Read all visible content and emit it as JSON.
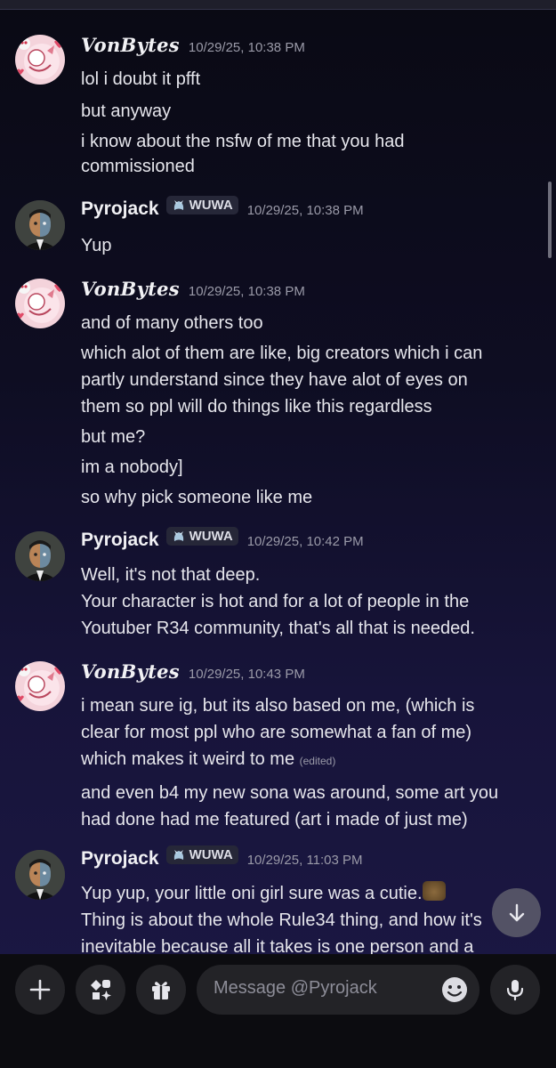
{
  "messages": [
    {
      "author": "VonBytes",
      "timestamp": "10/29/25, 10:38 PM",
      "lines": [
        "lol i doubt it pfft",
        "but anyway",
        "i know about the nsfw of me that you had",
        "commissioned"
      ]
    },
    {
      "author": "Pyrojack",
      "tag": "WUWA",
      "timestamp": "10/29/25, 10:38 PM",
      "lines": [
        "Yup"
      ]
    },
    {
      "author": "VonBytes",
      "timestamp": "10/29/25, 10:38 PM",
      "lines": [
        "and of many others too",
        "which alot of them are like, big creators which i can",
        "partly understand since they have alot of eyes on",
        "them so ppl will do things like this regardless",
        "but me?",
        "im a nobody]",
        "so why pick someone like me"
      ]
    },
    {
      "author": "Pyrojack",
      "tag": "WUWA",
      "timestamp": "10/29/25, 10:42 PM",
      "lines": [
        "Well, it's not that deep.",
        "Your character is hot and for a lot of people in the",
        "Youtuber R34 community, that's all that is needed."
      ]
    },
    {
      "author": "VonBytes",
      "timestamp": "10/29/25, 10:43 PM",
      "lines": [
        "i mean sure ig, but its also based on me, (which is",
        "clear for most ppl who are somewhat a fan of me)",
        "which makes it weird to me",
        "and even b4 my new sona was around, some art you",
        "had done had me featured (art i made of just me)"
      ],
      "edited_label": "(edited)"
    },
    {
      "author": "Pyrojack",
      "tag": "WUWA",
      "timestamp": "10/29/25, 11:03 PM",
      "lines": [
        "Yup yup, your little oni girl sure was a cutie.",
        "Thing is about the whole Rule34 thing, and how it's",
        "inevitable because all it takes is one person and a"
      ]
    }
  ],
  "composer": {
    "placeholder": "Message @Pyrojack"
  },
  "icons": {
    "add": "plus-icon",
    "apps": "apps-icon",
    "gift": "gift-icon",
    "emoji": "emoji-icon",
    "mic": "microphone-icon",
    "jump": "arrow-down-icon",
    "tag": "tag-emblem-icon"
  },
  "colors": {
    "background_top": "#0a0a14",
    "background_bottom": "#1c1845",
    "composer": "#0c0c10",
    "pill": "#232327",
    "muted_text": "#9a9aa8"
  }
}
